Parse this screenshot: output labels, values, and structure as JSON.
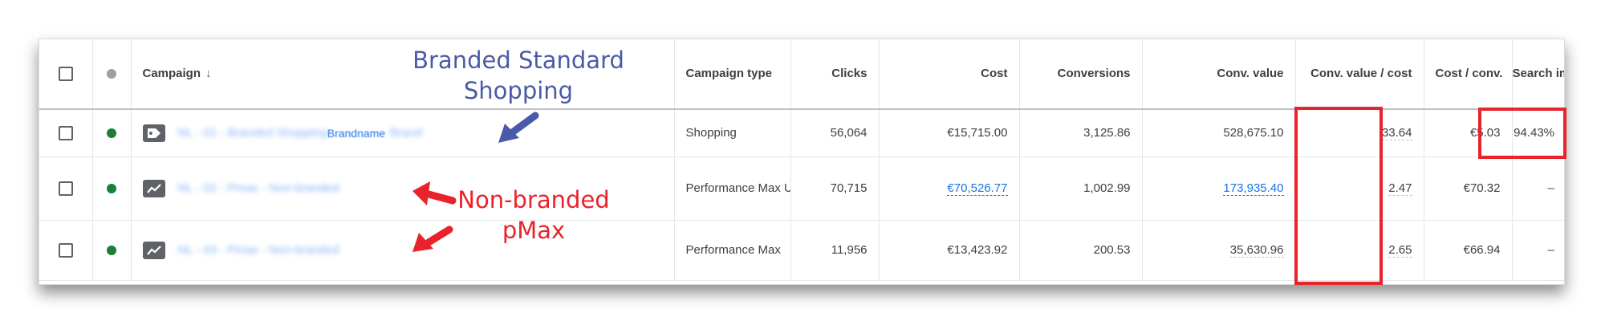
{
  "table": {
    "headers": {
      "campaign": "Campaign",
      "sort_indicator": "↓",
      "campaign_type": "Campaign type",
      "clicks": "Clicks",
      "cost": "Cost",
      "conversions": "Conversions",
      "conv_value": "Conv. value",
      "conv_value_cost": "Conv. value / cost",
      "cost_conv": "Cost / conv.",
      "search_impr_share": "Search impr. share"
    },
    "rows": [
      {
        "campaign_name": "NL - 01 - Branded Shopping",
        "campaign_brandname": "Brandname",
        "campaign_name_tail": "Brand",
        "campaign_type": "Shopping",
        "clicks": "56,064",
        "cost": "€15,715.00",
        "conversions": "3,125.86",
        "conv_value": "528,675.10",
        "conv_value_cost": "33.64",
        "cost_conv": "€5.03",
        "search_impr_share": "94.43%"
      },
      {
        "campaign_name": "NL - 02 - Pmax - Non-branded",
        "campaign_type": "Performance Max Upgraded",
        "clicks": "70,715",
        "cost": "€70,526.77",
        "conversions": "1,002.99",
        "conv_value": "173,935.40",
        "conv_value_cost": "2.47",
        "cost_conv": "€70.32",
        "search_impr_share": "–"
      },
      {
        "campaign_name": "NL - 03 - Pmax - Non-branded",
        "campaign_type": "Performance Max",
        "clicks": "11,956",
        "cost": "€13,423.92",
        "conversions": "200.53",
        "conv_value": "35,630.96",
        "conv_value_cost": "2.65",
        "cost_conv": "€66.94",
        "search_impr_share": "–"
      }
    ]
  },
  "annotations": {
    "branded": "Branded Standard Shopping",
    "non_branded": "Non-branded pMax"
  },
  "colors": {
    "annotation_blue": "#4a5aa8",
    "annotation_red": "#e8232b",
    "status_enabled": "#188038",
    "link": "#1a73e8"
  }
}
